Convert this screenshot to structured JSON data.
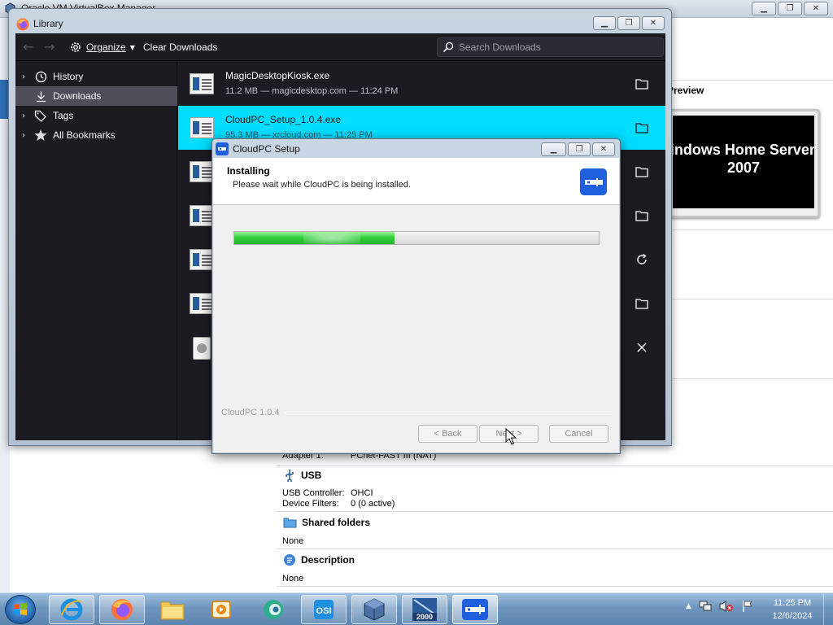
{
  "vbox": {
    "title": "Oracle VM VirtualBox Manager",
    "preview": {
      "label": "Preview",
      "screen_text_line1": "Windows Home Server",
      "screen_text_line2": "2007"
    },
    "network_line": {
      "key": "Adapter 1:",
      "value": "PCnet-FAST III (NAT)"
    },
    "usb": {
      "title": "USB",
      "controller": {
        "key": "USB Controller:",
        "value": "OHCI"
      },
      "filters": {
        "key": "Device Filters:",
        "value": "0 (0 active)"
      }
    },
    "shared_folders": {
      "title": "Shared folders",
      "value": "None"
    },
    "description": {
      "title": "Description",
      "value": "None"
    }
  },
  "library": {
    "title": "Library",
    "toolbar": {
      "organize_label": "Organize",
      "clear_label": "Clear Downloads",
      "search_placeholder": "Search Downloads"
    },
    "sidebar": {
      "items": [
        {
          "label": "History",
          "icon": "clock-icon",
          "expandable": true,
          "selected": false
        },
        {
          "label": "Downloads",
          "icon": "download-icon",
          "expandable": false,
          "selected": true
        },
        {
          "label": "Tags",
          "icon": "tag-icon",
          "expandable": true,
          "selected": false
        },
        {
          "label": "All Bookmarks",
          "icon": "star-icon",
          "expandable": true,
          "selected": false
        }
      ]
    },
    "downloads": [
      {
        "name": "MagicDesktopKiosk.exe",
        "meta": "11.2 MB — magicdesktop.com — 11:24 PM",
        "action": "folder-icon",
        "selected": false
      },
      {
        "name": "CloudPC_Setup_1.0.4.exe",
        "meta": "95.3 MB — xrcloud.com — 11:25 PM",
        "action": "folder-icon",
        "selected": true
      },
      {
        "name": "",
        "meta": "",
        "action": "folder-icon",
        "selected": false
      },
      {
        "name": "",
        "meta": "",
        "action": "folder-icon",
        "selected": false
      },
      {
        "name": "",
        "meta": "",
        "action": "retry-icon",
        "selected": false
      },
      {
        "name": "",
        "meta": "",
        "action": "folder-icon",
        "selected": false
      },
      {
        "name": "",
        "meta": "",
        "action": "close-icon",
        "selected": false
      }
    ]
  },
  "setup": {
    "title": "CloudPC Setup",
    "heading": "Installing",
    "subheading": "Please wait while CloudPC is being installed.",
    "progress": 0.44,
    "brand": "CloudPC 1.0.4",
    "buttons": {
      "back": "< Back",
      "next": "Next >",
      "cancel": "Cancel"
    }
  },
  "taskbar": {
    "apps": [
      "internet-explorer-icon",
      "firefox-icon",
      "file-explorer-icon",
      "media-player-icon",
      "cloud-app-icon",
      "osi-app-icon",
      "virtualbox-icon",
      "windows-2000-icon",
      "cloudpc-icon"
    ],
    "win2000_badge": "2000",
    "osi_label": "OSI",
    "clock_time": "11:25 PM",
    "clock_date": "12/6/2024"
  },
  "colors": {
    "selected_row": "#00ddff",
    "library_bg": "#1c1b22",
    "progress_green": "#2fce3b",
    "cloudpc_blue": "#1f5fde"
  }
}
